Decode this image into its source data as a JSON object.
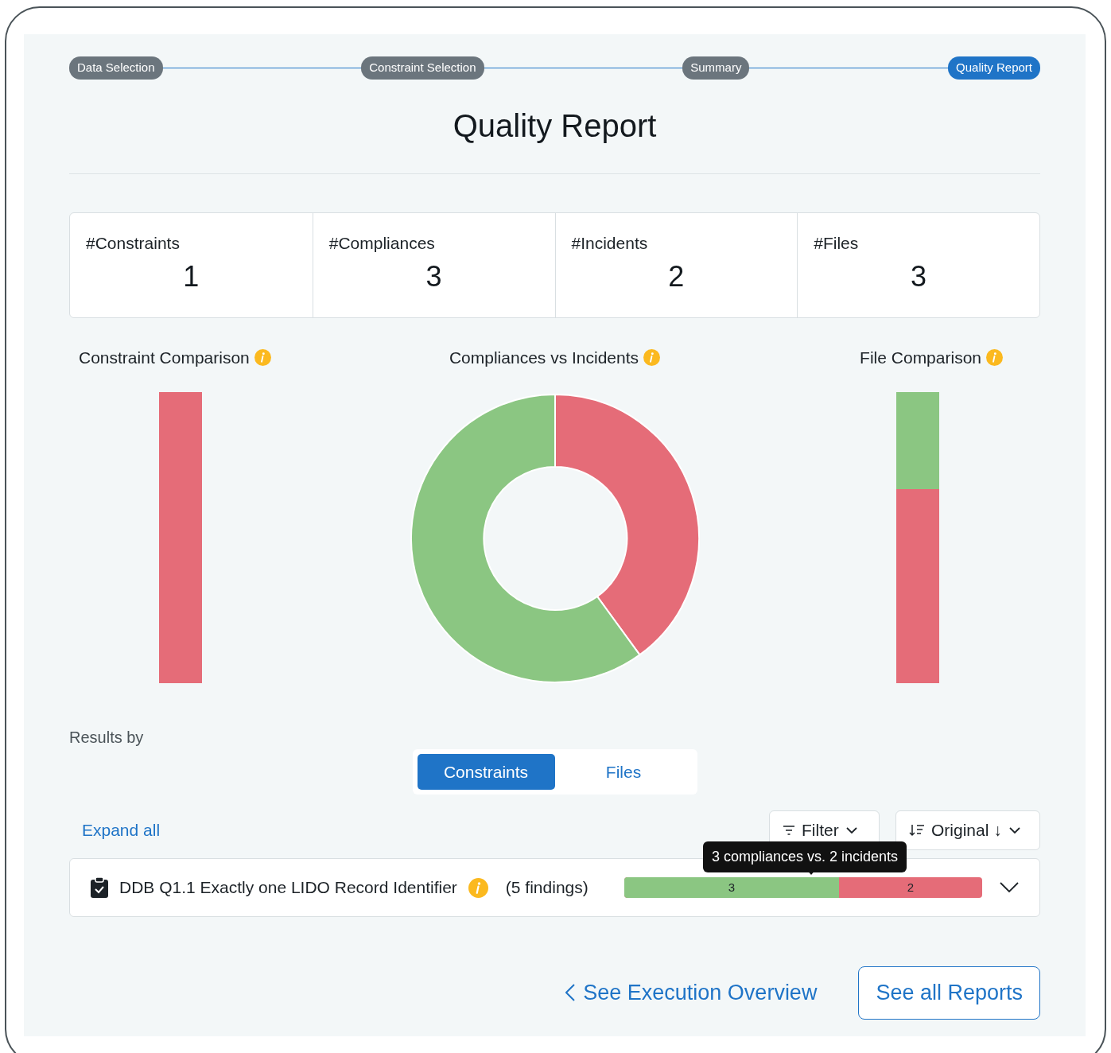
{
  "stepper": [
    {
      "label": "Data Selection",
      "selected": false
    },
    {
      "label": "Constraint Selection",
      "selected": false
    },
    {
      "label": "Summary",
      "selected": false
    },
    {
      "label": "Quality Report",
      "selected": true
    }
  ],
  "title": "Quality Report",
  "stats": [
    {
      "label": "#Constraints",
      "value": "1"
    },
    {
      "label": "#Compliances",
      "value": "3"
    },
    {
      "label": "#Incidents",
      "value": "2"
    },
    {
      "label": "#Files",
      "value": "3"
    }
  ],
  "charts": [
    {
      "kind": "bar-constraints",
      "title": "Constraint Comparison"
    },
    {
      "kind": "donut",
      "title": "Compliances vs Incidents"
    },
    {
      "kind": "bar-files",
      "title": "File Comparison"
    }
  ],
  "results_by": {
    "label": "Results by",
    "tabs": [
      {
        "label": "Constraints",
        "selected": true
      },
      {
        "label": "Files",
        "selected": false
      }
    ]
  },
  "expand_all": "Expand all",
  "filter": {
    "label": "Filter"
  },
  "sort": {
    "label": "Original ↓"
  },
  "tooltip": "3 compliances vs. 2 incidents",
  "results": [
    {
      "name": "DDB Q1.1 Exactly one LIDO Record Identifier",
      "findings": "(5 findings)",
      "compliances": "3",
      "incidents": "2",
      "level": 0.6
    }
  ],
  "footer": {
    "back": "See Execution Overview",
    "reports": "See all Reports"
  }
}
